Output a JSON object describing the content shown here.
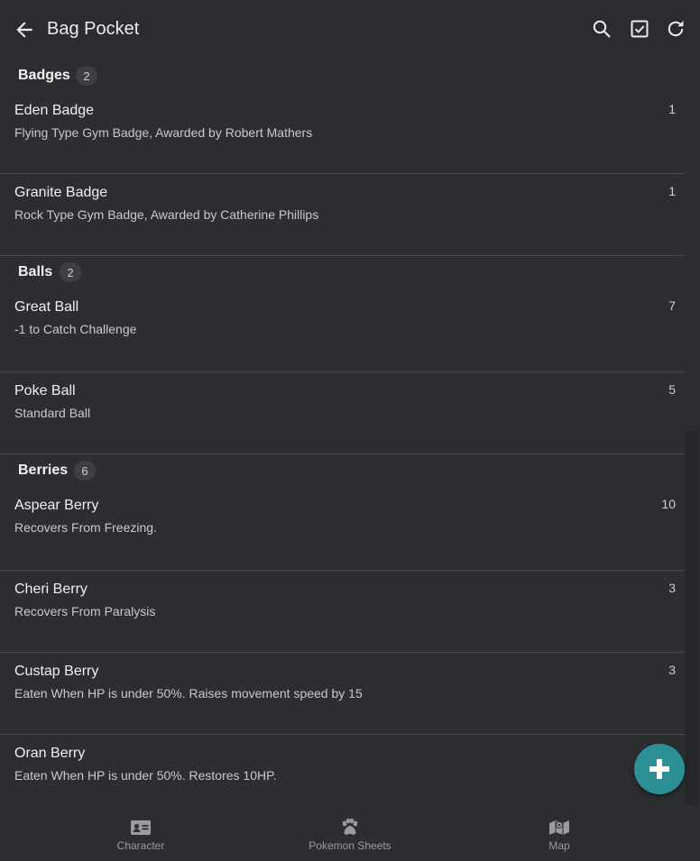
{
  "appbar": {
    "title": "Bag Pocket",
    "icons": [
      "arrow-back-icon",
      "search-icon",
      "checkbox-icon",
      "refresh-icon"
    ]
  },
  "groups": [
    {
      "name": "Badges",
      "count": "2",
      "items": [
        {
          "name": "Eden Badge",
          "desc": "Flying Type Gym Badge, Awarded by Robert Mathers",
          "qty": "1"
        },
        {
          "name": "Granite Badge",
          "desc": "Rock Type Gym Badge, Awarded by Catherine Phillips",
          "qty": "1"
        }
      ]
    },
    {
      "name": "Balls",
      "count": "2",
      "items": [
        {
          "name": "Great Ball",
          "desc": "-1 to Catch Challenge",
          "qty": "7"
        },
        {
          "name": "Poke Ball",
          "desc": "Standard Ball",
          "qty": "5"
        }
      ]
    },
    {
      "name": "Berries",
      "count": "6",
      "items": [
        {
          "name": "Aspear Berry",
          "desc": "Recovers From Freezing.",
          "qty": "10"
        },
        {
          "name": "Cheri Berry",
          "desc": "Recovers From Paralysis",
          "qty": "3"
        },
        {
          "name": "Custap Berry",
          "desc": "Eaten When HP is under 50%. Raises movement speed by 15",
          "qty": "3"
        },
        {
          "name": "Oran Berry",
          "desc": "Eaten When HP is under 50%. Restores 10HP.",
          "qty": ""
        }
      ]
    }
  ],
  "fab": {
    "icon": "plus-icon",
    "color": "#2c8f96"
  },
  "bottom_nav": [
    {
      "label": "Character",
      "icon": "id-card-icon"
    },
    {
      "label": "Pokemon Sheets",
      "icon": "paw-icon"
    },
    {
      "label": "Map",
      "icon": "map-icon"
    }
  ]
}
